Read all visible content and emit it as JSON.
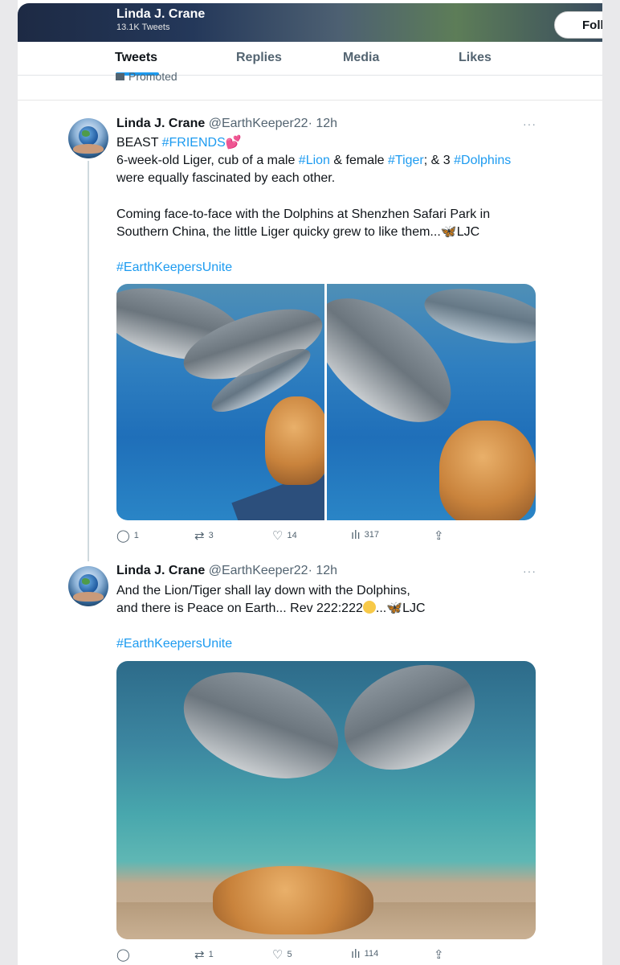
{
  "header": {
    "name": "Linda J. Crane",
    "tweet_count": "13.1K Tweets",
    "follow_label": "Foll"
  },
  "tabs": [
    {
      "label": "Tweets",
      "active": true
    },
    {
      "label": "Replies",
      "active": false
    },
    {
      "label": "Media",
      "active": false
    },
    {
      "label": "Likes",
      "active": false
    }
  ],
  "promoted": "Promoted",
  "tweets": [
    {
      "name": "Linda J. Crane",
      "handle": "@EarthKeeper22",
      "time": "· 12h",
      "line1_a": "BEAST ",
      "line1_tag": "#FRIENDS",
      "line1_emoji": "💕",
      "line2_a": "6-week-old Liger, cub of a male ",
      "line2_tag1": "#Lion",
      "line2_b": " & female ",
      "line2_tag2": "#Tiger",
      "line2_c": "; & 3 ",
      "line2_tag3": "#Dolphins",
      "line3": "were equally fascinated by each other.",
      "line4": "Coming face-to-face with the Dolphins at Shenzhen Safari Park in",
      "line5_a": "Southern China, the little Liger quicky grew to like them...",
      "line5_emoji": "🦋",
      "line5_b": "LJC",
      "hashtag": "#EarthKeepersUnite",
      "replies": "1",
      "retweets": "3",
      "likes": "14",
      "views": "317"
    },
    {
      "name": "Linda J. Crane",
      "handle": "@EarthKeeper22",
      "time": "· 12h",
      "line1": "And the Lion/Tiger shall lay down with the Dolphins,",
      "line2_a": "and there is Peace on Earth... Rev 222:222",
      "line2_b": "...",
      "line2_emoji": "🦋",
      "line2_c": "LJC",
      "hashtag": "#EarthKeepersUnite",
      "replies": "",
      "retweets": "1",
      "likes": "5",
      "views": "114"
    }
  ],
  "icons": {
    "reply": "reply-icon",
    "retweet": "retweet-icon",
    "like": "heart-icon",
    "views": "views-icon",
    "share": "share-icon",
    "more": "more-icon"
  },
  "colors": {
    "link": "#1d9bf0",
    "text": "#0f1419",
    "muted": "#536471"
  }
}
